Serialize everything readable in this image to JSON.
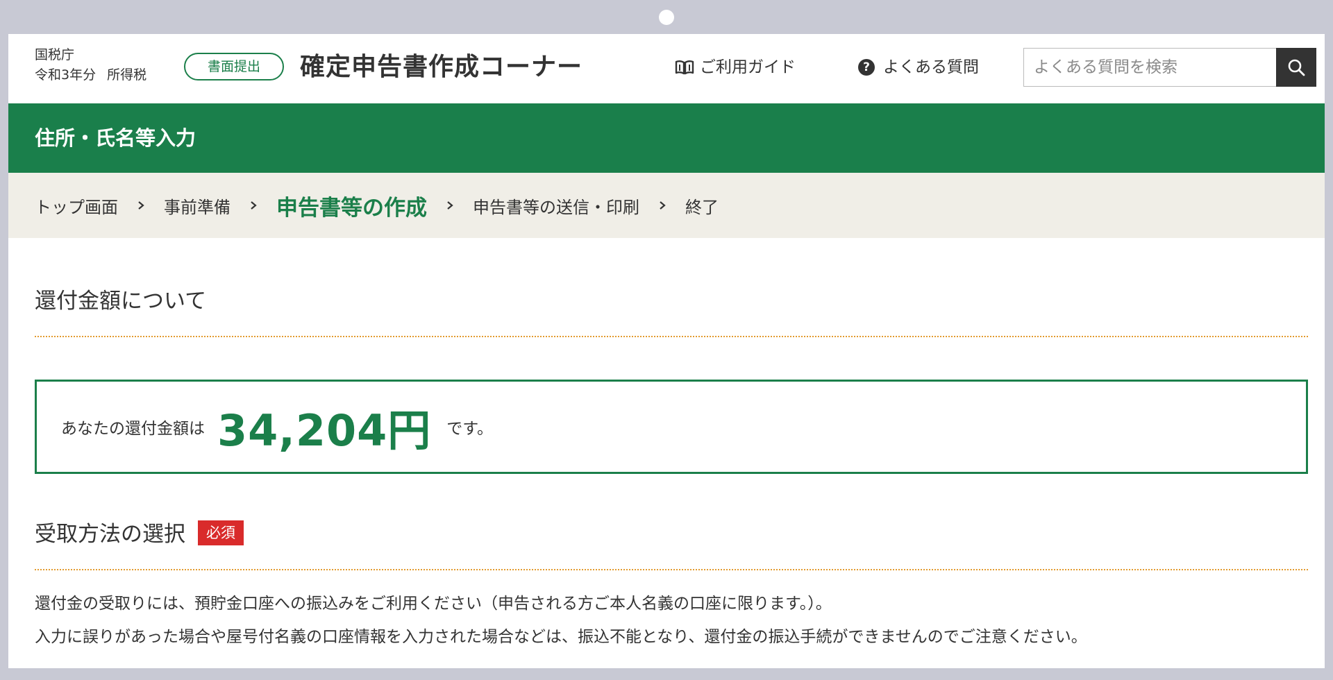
{
  "header": {
    "agency": "国税庁",
    "year": "令和3年分",
    "tax_type": "所得税",
    "submit_badge": "書面提出",
    "corner_title": "確定申告書作成コーナー",
    "guide_label": "ご利用ガイド",
    "faq_label": "よくある質問",
    "faq_icon_glyph": "?",
    "search_placeholder": "よくある質問を検索"
  },
  "page_title": "住所・氏名等入力",
  "breadcrumb": [
    {
      "label": "トップ画面",
      "current": false
    },
    {
      "label": "事前準備",
      "current": false
    },
    {
      "label": "申告書等の作成",
      "current": true
    },
    {
      "label": "申告書等の送信・印刷",
      "current": false
    },
    {
      "label": "終了",
      "current": false
    }
  ],
  "refund_section": {
    "heading": "還付金額について",
    "prefix": "あなたの還付金額は",
    "amount": "34,204円",
    "suffix": "です。"
  },
  "receipt_section": {
    "heading": "受取方法の選択",
    "required_badge": "必須",
    "notes": [
      "還付金の受取りには、預貯金口座への振込みをご利用ください（申告される方ご本人名義の口座に限ります。）。",
      "入力に誤りがあった場合や屋号付名義の口座情報を入力された場合などは、振込不能となり、還付金の振込手続ができませんのでご注意ください。"
    ]
  },
  "colors": {
    "brand_green": "#1a7f4b",
    "required_red": "#d92b2b",
    "divider_orange": "#e39a2d",
    "breadcrumb_bg": "#f0eee7",
    "frame": "#c8c9d4"
  },
  "icons": {
    "guide": "book-icon",
    "faq": "question-circle-icon",
    "search": "magnifier-icon",
    "breadcrumb_separator": "chevron-right-icon"
  }
}
